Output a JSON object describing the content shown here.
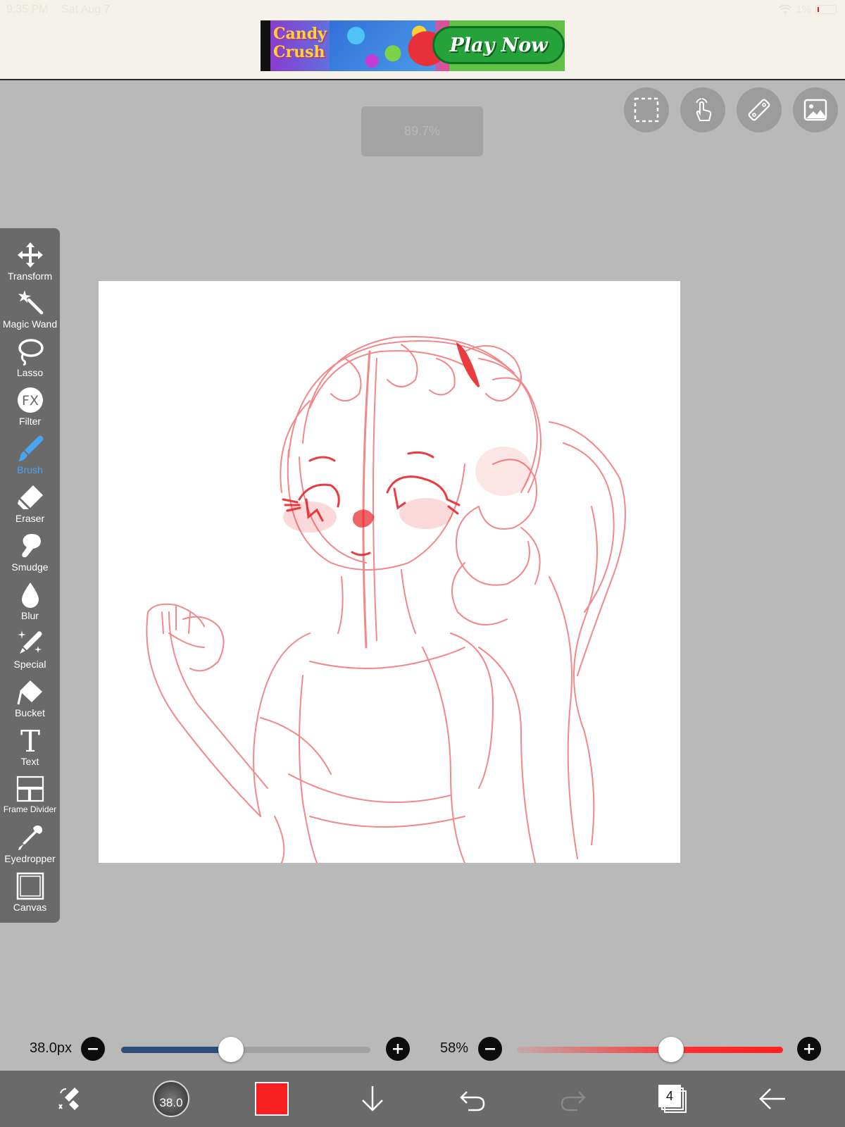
{
  "status_bar": {
    "time": "9:35 PM",
    "date": "Sat Aug 7",
    "battery": "1%"
  },
  "ad": {
    "logo_line1": "Candy",
    "logo_line2": "Crush",
    "cta": "Play Now"
  },
  "zoom": "89.7%",
  "top_buttons": [
    {
      "icon": "selection-icon"
    },
    {
      "icon": "hand-gesture-icon"
    },
    {
      "icon": "ruler-icon"
    },
    {
      "icon": "image-icon"
    }
  ],
  "tools": [
    {
      "label": "Transform",
      "icon": "move-arrows-icon"
    },
    {
      "label": "Magic Wand",
      "icon": "magic-wand-icon"
    },
    {
      "label": "Lasso",
      "icon": "lasso-icon"
    },
    {
      "label": "Filter",
      "icon": "fx-icon"
    },
    {
      "label": "Brush",
      "icon": "brush-icon",
      "active": true
    },
    {
      "label": "Eraser",
      "icon": "eraser-icon"
    },
    {
      "label": "Smudge",
      "icon": "smudge-icon"
    },
    {
      "label": "Blur",
      "icon": "drop-icon"
    },
    {
      "label": "Special",
      "icon": "sparkle-pen-icon"
    },
    {
      "label": "Bucket",
      "icon": "bucket-icon"
    },
    {
      "label": "Text",
      "icon": "text-icon"
    },
    {
      "label": "Frame Divider",
      "icon": "frame-divider-icon"
    },
    {
      "label": "Eyedropper",
      "icon": "eyedropper-icon"
    },
    {
      "label": "Canvas",
      "icon": "canvas-icon"
    }
  ],
  "brush_size": {
    "label": "38.0px",
    "value": 38.0,
    "fraction": 0.44
  },
  "opacity": {
    "label": "58%",
    "fraction": 0.58
  },
  "bottom_bar": {
    "brush_size_thumb": "38.0",
    "color": "#ff1c1c",
    "layers_count": "4"
  },
  "colors": {
    "accent_blue": "#4aa3f0",
    "toolbar_bg": "#6a6a6a",
    "workspace_bg": "#b9b9b9",
    "sketch_red": "#e8272b"
  }
}
